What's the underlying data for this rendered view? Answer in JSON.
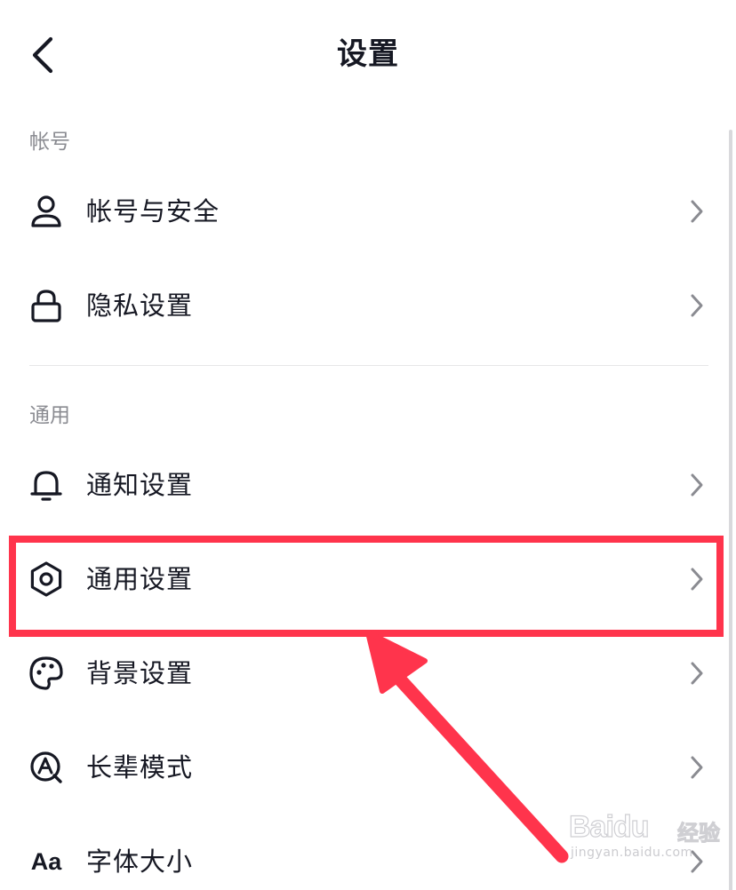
{
  "header": {
    "title": "设置",
    "back_icon": "chevron-left-icon"
  },
  "sections": [
    {
      "header": "帐号",
      "items": [
        {
          "label": "帐号与安全",
          "icon": "person-icon"
        },
        {
          "label": "隐私设置",
          "icon": "lock-icon"
        }
      ]
    },
    {
      "header": "通用",
      "items": [
        {
          "label": "通知设置",
          "icon": "bell-icon"
        },
        {
          "label": "通用设置",
          "icon": "gear-icon",
          "highlighted": true
        },
        {
          "label": "背景设置",
          "icon": "palette-icon"
        },
        {
          "label": "长辈模式",
          "icon": "elder-mode-icon"
        },
        {
          "label": "字体大小",
          "icon": "font-size-icon",
          "icon_text": "Aa"
        }
      ]
    }
  ],
  "annotation": {
    "highlight_color": "#ff344c",
    "target": "通用设置"
  },
  "watermark": {
    "logo": "Bai",
    "logo_tail": "du",
    "label": "经验",
    "url": "jingyan.baidu.com"
  },
  "colors": {
    "text_primary": "#161823",
    "text_secondary": "#8a8b91",
    "divider": "#e6e6e8",
    "chevron": "#8a8b91"
  }
}
